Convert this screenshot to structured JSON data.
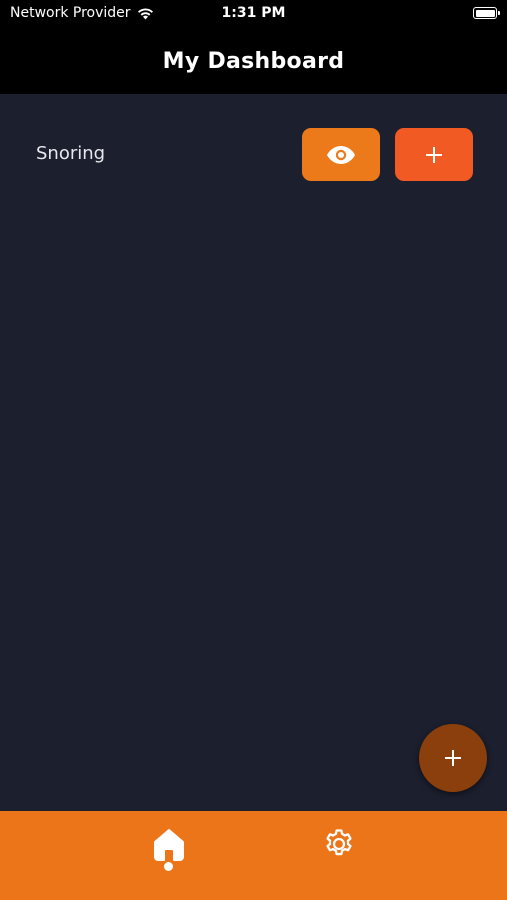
{
  "status_bar": {
    "carrier": "Network Provider",
    "time": "1:31 PM"
  },
  "header": {
    "title": "My Dashboard"
  },
  "trackers": [
    {
      "label": "Snoring",
      "actions": [
        "eye-icon",
        "plus-icon"
      ]
    }
  ],
  "nav": {
    "items": [
      "home-icon",
      "gear-icon"
    ],
    "active": "home"
  },
  "colors": {
    "background": "#1b1f2e",
    "header": "#000000",
    "view_button": "#ec7a1a",
    "add_button": "#f25a23",
    "fab": "#8a3f0c",
    "bottom_nav": "#ec7519"
  }
}
